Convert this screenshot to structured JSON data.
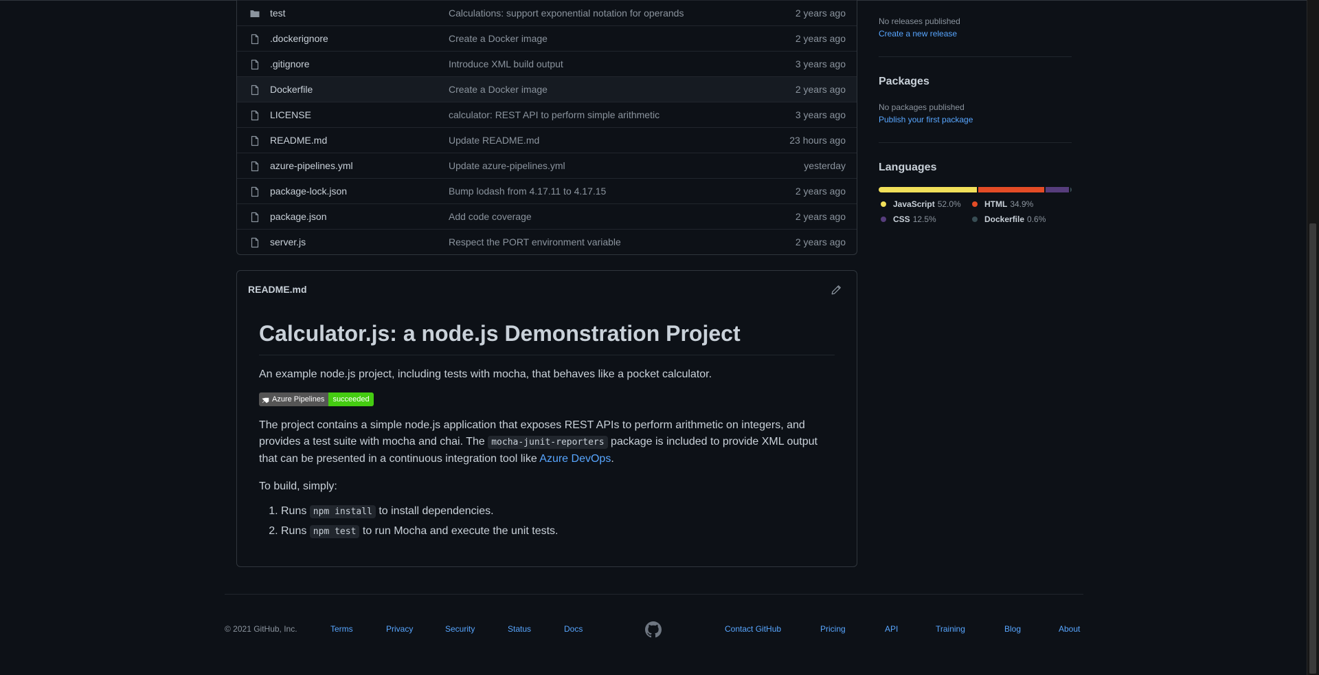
{
  "files": [
    {
      "name": "test",
      "type": "folder",
      "message": "Calculations: support exponential notation for operands",
      "time": "2 years ago"
    },
    {
      "name": ".dockerignore",
      "type": "file",
      "message": "Create a Docker image",
      "time": "2 years ago"
    },
    {
      "name": ".gitignore",
      "type": "file",
      "message": "Introduce XML build output",
      "time": "3 years ago"
    },
    {
      "name": "Dockerfile",
      "type": "file",
      "message": "Create a Docker image",
      "time": "2 years ago"
    },
    {
      "name": "LICENSE",
      "type": "file",
      "message": "calculator: REST API to perform simple arithmetic",
      "time": "3 years ago"
    },
    {
      "name": "README.md",
      "type": "file",
      "message": "Update README.md",
      "time": "23 hours ago"
    },
    {
      "name": "azure-pipelines.yml",
      "type": "file",
      "message": "Update azure-pipelines.yml",
      "time": "yesterday"
    },
    {
      "name": "package-lock.json",
      "type": "file",
      "message": "Bump lodash from 4.17.11 to 4.17.15",
      "time": "2 years ago"
    },
    {
      "name": "package.json",
      "type": "file",
      "message": "Add code coverage",
      "time": "2 years ago"
    },
    {
      "name": "server.js",
      "type": "file",
      "message": "Respect the PORT environment variable",
      "time": "2 years ago"
    }
  ],
  "readme": {
    "filename": "README.md",
    "title": "Calculator.js: a node.js Demonstration Project",
    "intro": "An example node.js project, including tests with mocha, that behaves like a pocket calculator.",
    "badge_left": "Azure Pipelines",
    "badge_right": "succeeded",
    "para_a": "The project contains a simple node.js application that exposes REST APIs to perform arithmetic on integers, and provides a test suite with mocha and chai. The ",
    "para_code": "mocha-junit-reporters",
    "para_b": " package is included to provide XML output that can be presented in a continuous integration tool like ",
    "para_link": "Azure DevOps",
    "para_end": ".",
    "build_intro": "To build, simply:",
    "steps": [
      {
        "pre": "Runs ",
        "code": "npm install",
        "post": " to install dependencies."
      },
      {
        "pre": "Runs ",
        "code": "npm test",
        "post": " to run Mocha and execute the unit tests."
      }
    ]
  },
  "sidebar": {
    "releases_text": "No releases published",
    "releases_link": "Create a new release",
    "packages_heading": "Packages",
    "packages_text": "No packages published",
    "packages_link": "Publish your first package",
    "languages_heading": "Languages",
    "languages": [
      {
        "name": "JavaScript",
        "percent": "52.0%",
        "value": 52.0,
        "color": "#f1e05a"
      },
      {
        "name": "HTML",
        "percent": "34.9%",
        "value": 34.9,
        "color": "#e34c26"
      },
      {
        "name": "CSS",
        "percent": "12.5%",
        "value": 12.5,
        "color": "#563d7c"
      },
      {
        "name": "Dockerfile",
        "percent": "0.6%",
        "value": 0.6,
        "color": "#384d54"
      }
    ]
  },
  "footer": {
    "copyright": "© 2021 GitHub, Inc.",
    "links_left": [
      "Terms",
      "Privacy",
      "Security",
      "Status",
      "Docs"
    ],
    "links_right": [
      "Contact GitHub",
      "Pricing",
      "API",
      "Training",
      "Blog",
      "About"
    ],
    "logo_icon": "github-mark-icon"
  }
}
